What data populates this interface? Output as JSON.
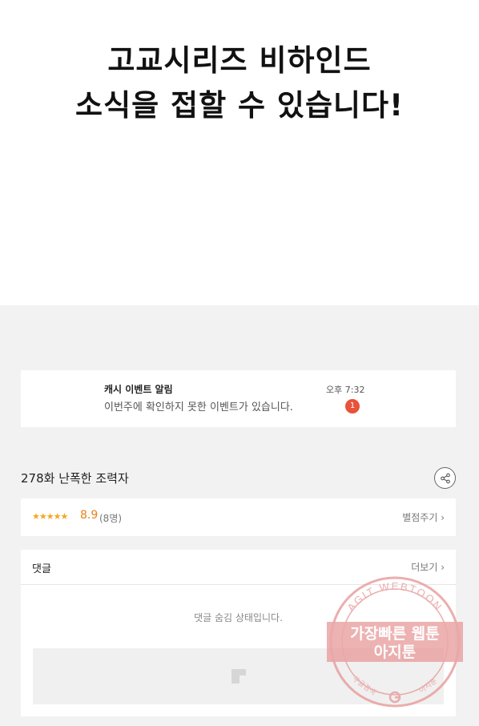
{
  "headline": {
    "line1": "고교시리즈 비하인드",
    "line2": "소식을 접할 수 있습니다!"
  },
  "notice": {
    "title": "캐시 이벤트 알림",
    "description": "이번주에 확인하지 못한 이벤트가 있습니다.",
    "time": "오후 7:32",
    "badge_count": "1"
  },
  "episode": {
    "title": "278화 난폭한 조력자"
  },
  "rating": {
    "stars": "★★★★★",
    "score": "8.9",
    "count": "(8명)",
    "rate_label": "별점주기 ›"
  },
  "comments": {
    "label": "댓글",
    "more_label": "더보기 ›",
    "hidden_message": "댓글 숨김 상태입니다."
  },
  "watermark": {
    "ring_text": "AGIT WEBTOON",
    "line1": "가장빠른 웹툰",
    "line2": "아지툰",
    "bottom_left": "구글검색",
    "bottom_right": "아지툰",
    "accent_color": "#e8a0a0"
  }
}
